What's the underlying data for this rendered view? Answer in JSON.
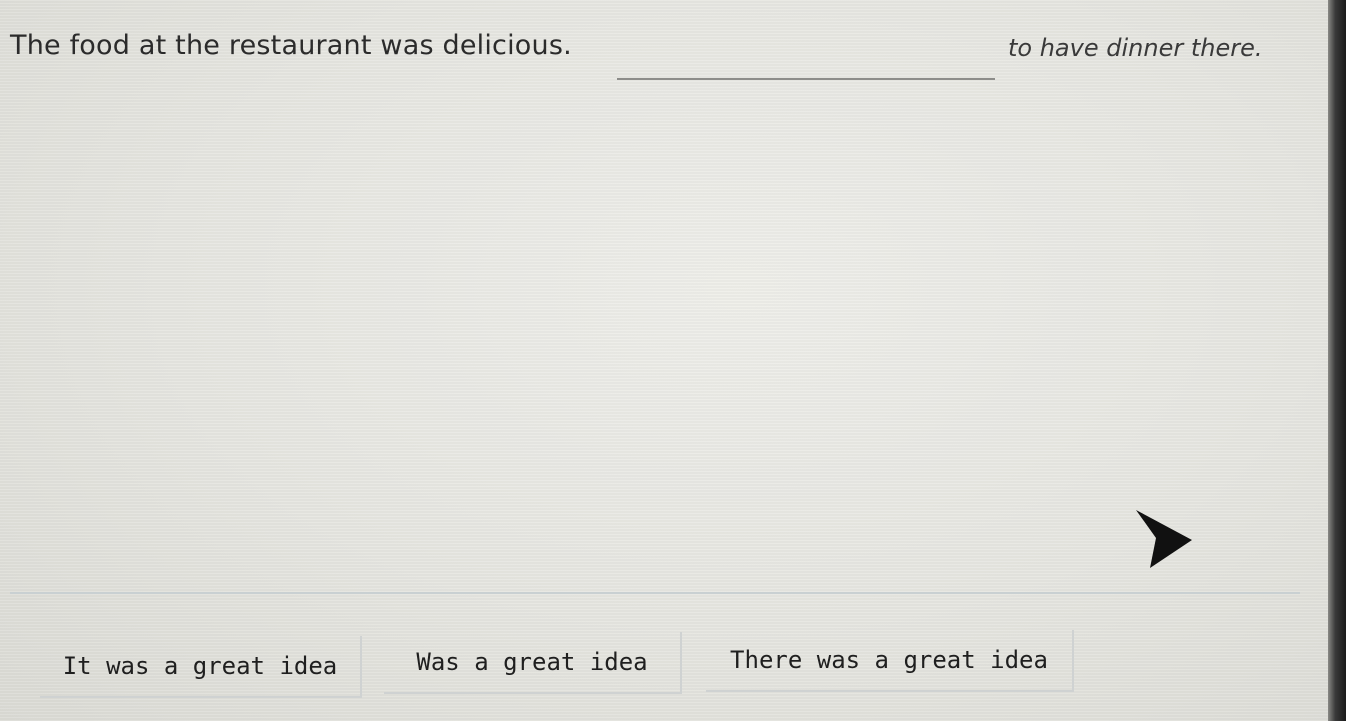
{
  "question": {
    "sentence_before": "The food at the restaurant was delicious.",
    "sentence_after": "to have dinner there."
  },
  "options": [
    {
      "label": "It was a great idea"
    },
    {
      "label": "Was a great idea"
    },
    {
      "label": "There was a great idea"
    }
  ],
  "icons": {
    "cursor": "mouse-pointer-icon"
  },
  "colors": {
    "background": "#e6e6e1",
    "text": "#2b2b2b",
    "blank_line": "#8d8d8a",
    "divider": "#c9d0d2"
  }
}
